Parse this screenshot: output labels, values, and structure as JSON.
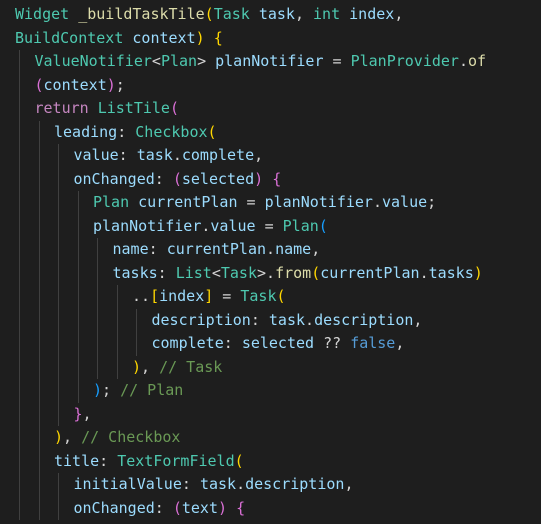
{
  "editor": {
    "background": "#1e1e1e",
    "token_colors": {
      "p": "#d4d4d4",
      "t": "#4ec9b0",
      "f": "#dcdcaa",
      "v": "#9cdcfe",
      "k": "#569cd6",
      "c": "#c586c0",
      "cm": "#6a9955",
      "b1": "#ffd700",
      "b2": "#da70d6",
      "b3": "#179fff"
    },
    "lines": [
      {
        "indent": 0,
        "tokens": [
          {
            "t": "Widget",
            "c": "t"
          },
          {
            "t": " ",
            "c": "p"
          },
          {
            "t": "_buildTaskTile",
            "c": "f"
          },
          {
            "t": "(",
            "c": "b1"
          },
          {
            "t": "Task",
            "c": "t"
          },
          {
            "t": " ",
            "c": "p"
          },
          {
            "t": "task",
            "c": "v"
          },
          {
            "t": ", ",
            "c": "p"
          },
          {
            "t": "int",
            "c": "t"
          },
          {
            "t": " ",
            "c": "p"
          },
          {
            "t": "index",
            "c": "v"
          },
          {
            "t": ",",
            "c": "p"
          }
        ]
      },
      {
        "indent": 0,
        "tokens": [
          {
            "t": "BuildContext",
            "c": "t"
          },
          {
            "t": " ",
            "c": "p"
          },
          {
            "t": "context",
            "c": "v"
          },
          {
            "t": ")",
            "c": "b1"
          },
          {
            "t": " ",
            "c": "p"
          },
          {
            "t": "{",
            "c": "b1"
          }
        ]
      },
      {
        "indent": 1,
        "tokens": [
          {
            "t": "ValueNotifier",
            "c": "t"
          },
          {
            "t": "<",
            "c": "p"
          },
          {
            "t": "Plan",
            "c": "t"
          },
          {
            "t": ">",
            "c": "p"
          },
          {
            "t": " ",
            "c": "p"
          },
          {
            "t": "planNotifier",
            "c": "v"
          },
          {
            "t": " = ",
            "c": "p"
          },
          {
            "t": "PlanProvider",
            "c": "t"
          },
          {
            "t": ".",
            "c": "p"
          },
          {
            "t": "of",
            "c": "f"
          }
        ]
      },
      {
        "indent": 1,
        "tokens": [
          {
            "t": "(",
            "c": "b2"
          },
          {
            "t": "context",
            "c": "v"
          },
          {
            "t": ")",
            "c": "b2"
          },
          {
            "t": ";",
            "c": "p"
          }
        ]
      },
      {
        "indent": 1,
        "tokens": [
          {
            "t": "return",
            "c": "c"
          },
          {
            "t": " ",
            "c": "p"
          },
          {
            "t": "ListTile",
            "c": "t"
          },
          {
            "t": "(",
            "c": "b2"
          }
        ]
      },
      {
        "indent": 2,
        "tokens": [
          {
            "t": "leading",
            "c": "v"
          },
          {
            "t": ": ",
            "c": "p"
          },
          {
            "t": "Checkbox",
            "c": "t"
          },
          {
            "t": "(",
            "c": "b1"
          }
        ]
      },
      {
        "indent": 3,
        "tokens": [
          {
            "t": "value",
            "c": "v"
          },
          {
            "t": ": ",
            "c": "p"
          },
          {
            "t": "task",
            "c": "v"
          },
          {
            "t": ".",
            "c": "p"
          },
          {
            "t": "complete",
            "c": "v"
          },
          {
            "t": ",",
            "c": "p"
          }
        ]
      },
      {
        "indent": 3,
        "tokens": [
          {
            "t": "onChanged",
            "c": "v"
          },
          {
            "t": ": ",
            "c": "p"
          },
          {
            "t": "(",
            "c": "b2"
          },
          {
            "t": "selected",
            "c": "v"
          },
          {
            "t": ")",
            "c": "b2"
          },
          {
            "t": " ",
            "c": "p"
          },
          {
            "t": "{",
            "c": "b2"
          }
        ]
      },
      {
        "indent": 4,
        "tokens": [
          {
            "t": "Plan",
            "c": "t"
          },
          {
            "t": " ",
            "c": "p"
          },
          {
            "t": "currentPlan",
            "c": "v"
          },
          {
            "t": " = ",
            "c": "p"
          },
          {
            "t": "planNotifier",
            "c": "v"
          },
          {
            "t": ".",
            "c": "p"
          },
          {
            "t": "value",
            "c": "v"
          },
          {
            "t": ";",
            "c": "p"
          }
        ]
      },
      {
        "indent": 4,
        "tokens": [
          {
            "t": "planNotifier",
            "c": "v"
          },
          {
            "t": ".",
            "c": "p"
          },
          {
            "t": "value",
            "c": "v"
          },
          {
            "t": " = ",
            "c": "p"
          },
          {
            "t": "Plan",
            "c": "t"
          },
          {
            "t": "(",
            "c": "b3"
          }
        ]
      },
      {
        "indent": 5,
        "tokens": [
          {
            "t": "name",
            "c": "v"
          },
          {
            "t": ": ",
            "c": "p"
          },
          {
            "t": "currentPlan",
            "c": "v"
          },
          {
            "t": ".",
            "c": "p"
          },
          {
            "t": "name",
            "c": "v"
          },
          {
            "t": ",",
            "c": "p"
          }
        ]
      },
      {
        "indent": 5,
        "tokens": [
          {
            "t": "tasks",
            "c": "v"
          },
          {
            "t": ": ",
            "c": "p"
          },
          {
            "t": "List",
            "c": "t"
          },
          {
            "t": "<",
            "c": "p"
          },
          {
            "t": "Task",
            "c": "t"
          },
          {
            "t": ">",
            "c": "p"
          },
          {
            "t": ".",
            "c": "p"
          },
          {
            "t": "from",
            "c": "f"
          },
          {
            "t": "(",
            "c": "b1"
          },
          {
            "t": "currentPlan",
            "c": "v"
          },
          {
            "t": ".",
            "c": "p"
          },
          {
            "t": "tasks",
            "c": "v"
          },
          {
            "t": ")",
            "c": "b1"
          }
        ]
      },
      {
        "indent": 6,
        "tokens": [
          {
            "t": "..",
            "c": "p"
          },
          {
            "t": "[",
            "c": "b1"
          },
          {
            "t": "index",
            "c": "v"
          },
          {
            "t": "]",
            "c": "b1"
          },
          {
            "t": " = ",
            "c": "p"
          },
          {
            "t": "Task",
            "c": "t"
          },
          {
            "t": "(",
            "c": "b1"
          }
        ]
      },
      {
        "indent": 7,
        "tokens": [
          {
            "t": "description",
            "c": "v"
          },
          {
            "t": ": ",
            "c": "p"
          },
          {
            "t": "task",
            "c": "v"
          },
          {
            "t": ".",
            "c": "p"
          },
          {
            "t": "description",
            "c": "v"
          },
          {
            "t": ",",
            "c": "p"
          }
        ]
      },
      {
        "indent": 7,
        "tokens": [
          {
            "t": "complete",
            "c": "v"
          },
          {
            "t": ": ",
            "c": "p"
          },
          {
            "t": "selected",
            "c": "v"
          },
          {
            "t": " ?? ",
            "c": "p"
          },
          {
            "t": "false",
            "c": "k"
          },
          {
            "t": ",",
            "c": "p"
          }
        ]
      },
      {
        "indent": 6,
        "tokens": [
          {
            "t": ")",
            "c": "b1"
          },
          {
            "t": ", ",
            "c": "p"
          },
          {
            "t": "// Task",
            "c": "cm"
          }
        ]
      },
      {
        "indent": 4,
        "tokens": [
          {
            "t": ")",
            "c": "b3"
          },
          {
            "t": "; ",
            "c": "p"
          },
          {
            "t": "// Plan",
            "c": "cm"
          }
        ]
      },
      {
        "indent": 3,
        "tokens": [
          {
            "t": "}",
            "c": "b2"
          },
          {
            "t": ",",
            "c": "p"
          }
        ]
      },
      {
        "indent": 2,
        "tokens": [
          {
            "t": ")",
            "c": "b1"
          },
          {
            "t": ", ",
            "c": "p"
          },
          {
            "t": "// Checkbox",
            "c": "cm"
          }
        ]
      },
      {
        "indent": 2,
        "tokens": [
          {
            "t": "title",
            "c": "v"
          },
          {
            "t": ": ",
            "c": "p"
          },
          {
            "t": "TextFormField",
            "c": "t"
          },
          {
            "t": "(",
            "c": "b1"
          }
        ]
      },
      {
        "indent": 3,
        "tokens": [
          {
            "t": "initialValue",
            "c": "v"
          },
          {
            "t": ": ",
            "c": "p"
          },
          {
            "t": "task",
            "c": "v"
          },
          {
            "t": ".",
            "c": "p"
          },
          {
            "t": "description",
            "c": "v"
          },
          {
            "t": ",",
            "c": "p"
          }
        ]
      },
      {
        "indent": 3,
        "tokens": [
          {
            "t": "onChanged",
            "c": "v"
          },
          {
            "t": ": ",
            "c": "p"
          },
          {
            "t": "(",
            "c": "b2"
          },
          {
            "t": "text",
            "c": "v"
          },
          {
            "t": ")",
            "c": "b2"
          },
          {
            "t": " ",
            "c": "p"
          },
          {
            "t": "{",
            "c": "b2"
          }
        ]
      }
    ]
  }
}
